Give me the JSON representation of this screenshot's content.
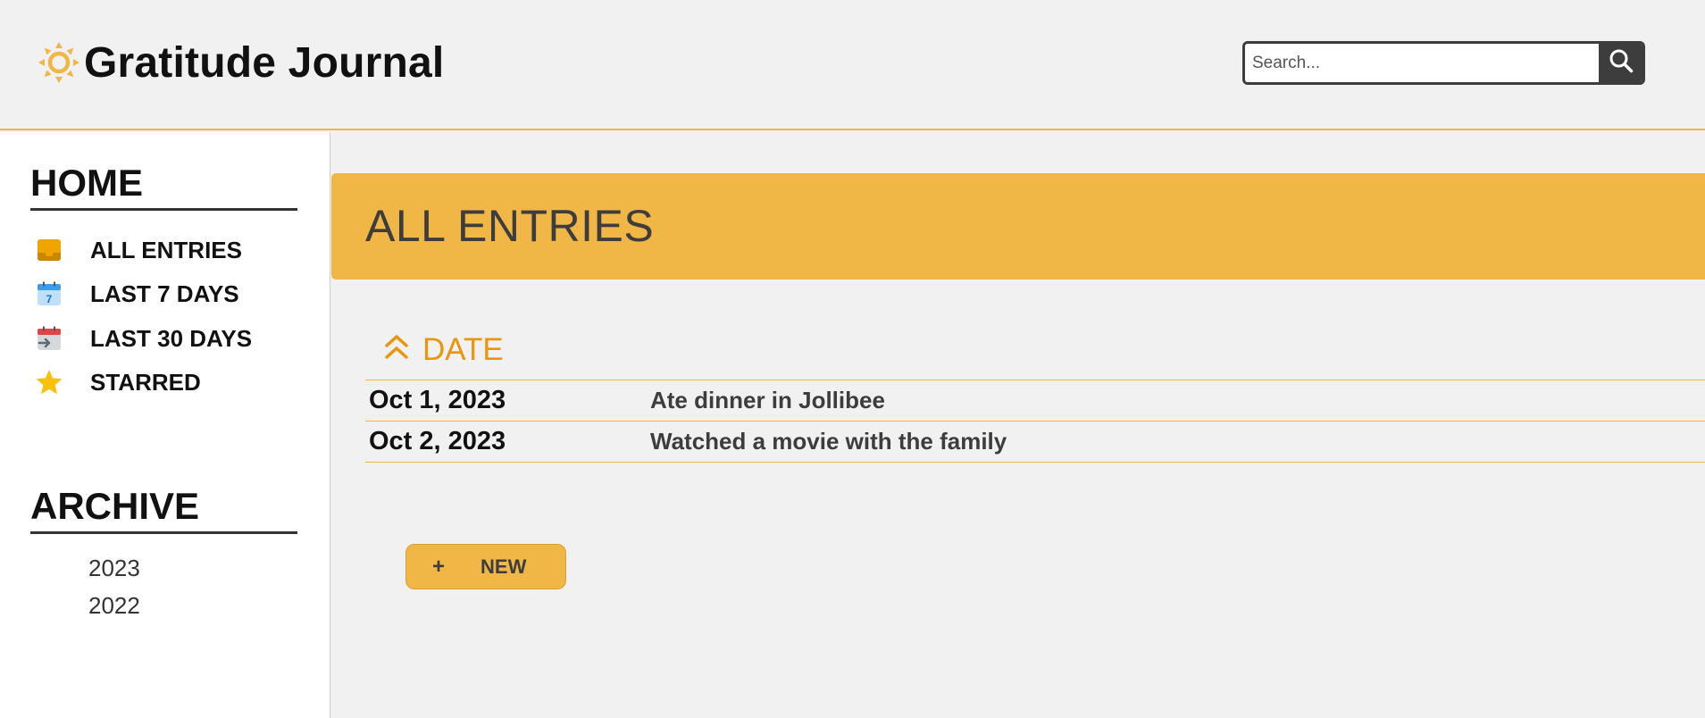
{
  "header": {
    "app_title": "Gratitude Journal",
    "logo_icon": "sun-icon",
    "search_placeholder": "Search...",
    "search_value": "",
    "search_icon": "magnifier-icon"
  },
  "sidebar": {
    "home_title": "HOME",
    "items": [
      {
        "label": "ALL ENTRIES",
        "icon": "inbox-tray-icon"
      },
      {
        "label": "LAST 7 DAYS",
        "icon": "calendar-7-icon"
      },
      {
        "label": "LAST 30 DAYS",
        "icon": "calendar-arrow-icon"
      },
      {
        "label": "STARRED",
        "icon": "star-icon"
      }
    ],
    "archive_title": "ARCHIVE",
    "archive_years": [
      "2023",
      "2022"
    ]
  },
  "main": {
    "banner_title": "ALL ENTRIES",
    "sort_label": "DATE",
    "sort_icon": "chevron-up-icon",
    "entries": [
      {
        "date": "Oct 1, 2023",
        "text": "Ate dinner in Jollibee"
      },
      {
        "date": "Oct 2, 2023",
        "text": "Watched a movie with the family"
      }
    ],
    "new_button": {
      "icon": "+",
      "label": "NEW"
    }
  },
  "colors": {
    "accent": "#f0b646",
    "sort_accent": "#e8950f",
    "dark": "#3d3d3d",
    "background": "#f1f1f1"
  }
}
